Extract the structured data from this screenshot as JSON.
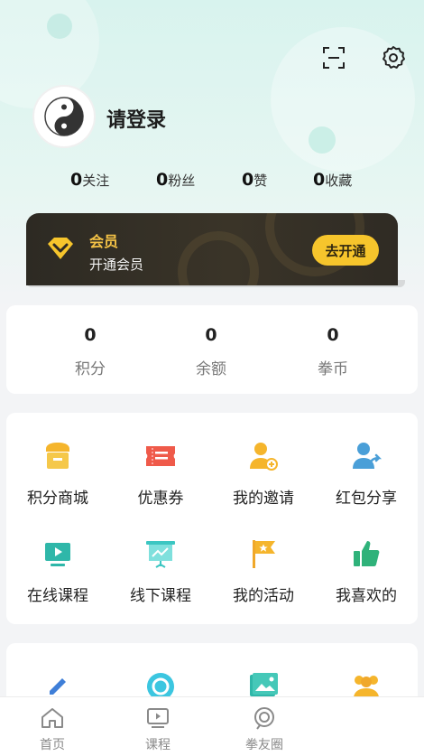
{
  "header": {
    "login_text": "请登录",
    "stats": [
      {
        "value": "0",
        "label": "关注"
      },
      {
        "value": "0",
        "label": "粉丝"
      },
      {
        "value": "0",
        "label": "赞"
      },
      {
        "value": "0",
        "label": "收藏"
      }
    ]
  },
  "vip": {
    "title": "会员",
    "subtitle": "开通会员",
    "button": "去开通"
  },
  "wallet": [
    {
      "value": "0",
      "label": "积分"
    },
    {
      "value": "0",
      "label": "余额"
    },
    {
      "value": "0",
      "label": "拳币"
    }
  ],
  "menu": [
    {
      "label": "积分商城",
      "icon": "shop-icon"
    },
    {
      "label": "优惠券",
      "icon": "coupon-icon"
    },
    {
      "label": "我的邀请",
      "icon": "invite-icon"
    },
    {
      "label": "红包分享",
      "icon": "share-icon"
    },
    {
      "label": "在线课程",
      "icon": "online-course-icon"
    },
    {
      "label": "线下课程",
      "icon": "offline-course-icon"
    },
    {
      "label": "我的活动",
      "icon": "activity-flag-icon"
    },
    {
      "label": "我喜欢的",
      "icon": "thumbs-up-icon"
    }
  ],
  "nav": [
    {
      "label": "首页",
      "icon": "home-icon"
    },
    {
      "label": "课程",
      "icon": "course-icon"
    },
    {
      "label": "拳友圈",
      "icon": "community-icon"
    }
  ],
  "colors": {
    "accent_yellow": "#f6c52c",
    "vip_bg": "#2d2a23",
    "header_bg": "#d8f3ee"
  }
}
